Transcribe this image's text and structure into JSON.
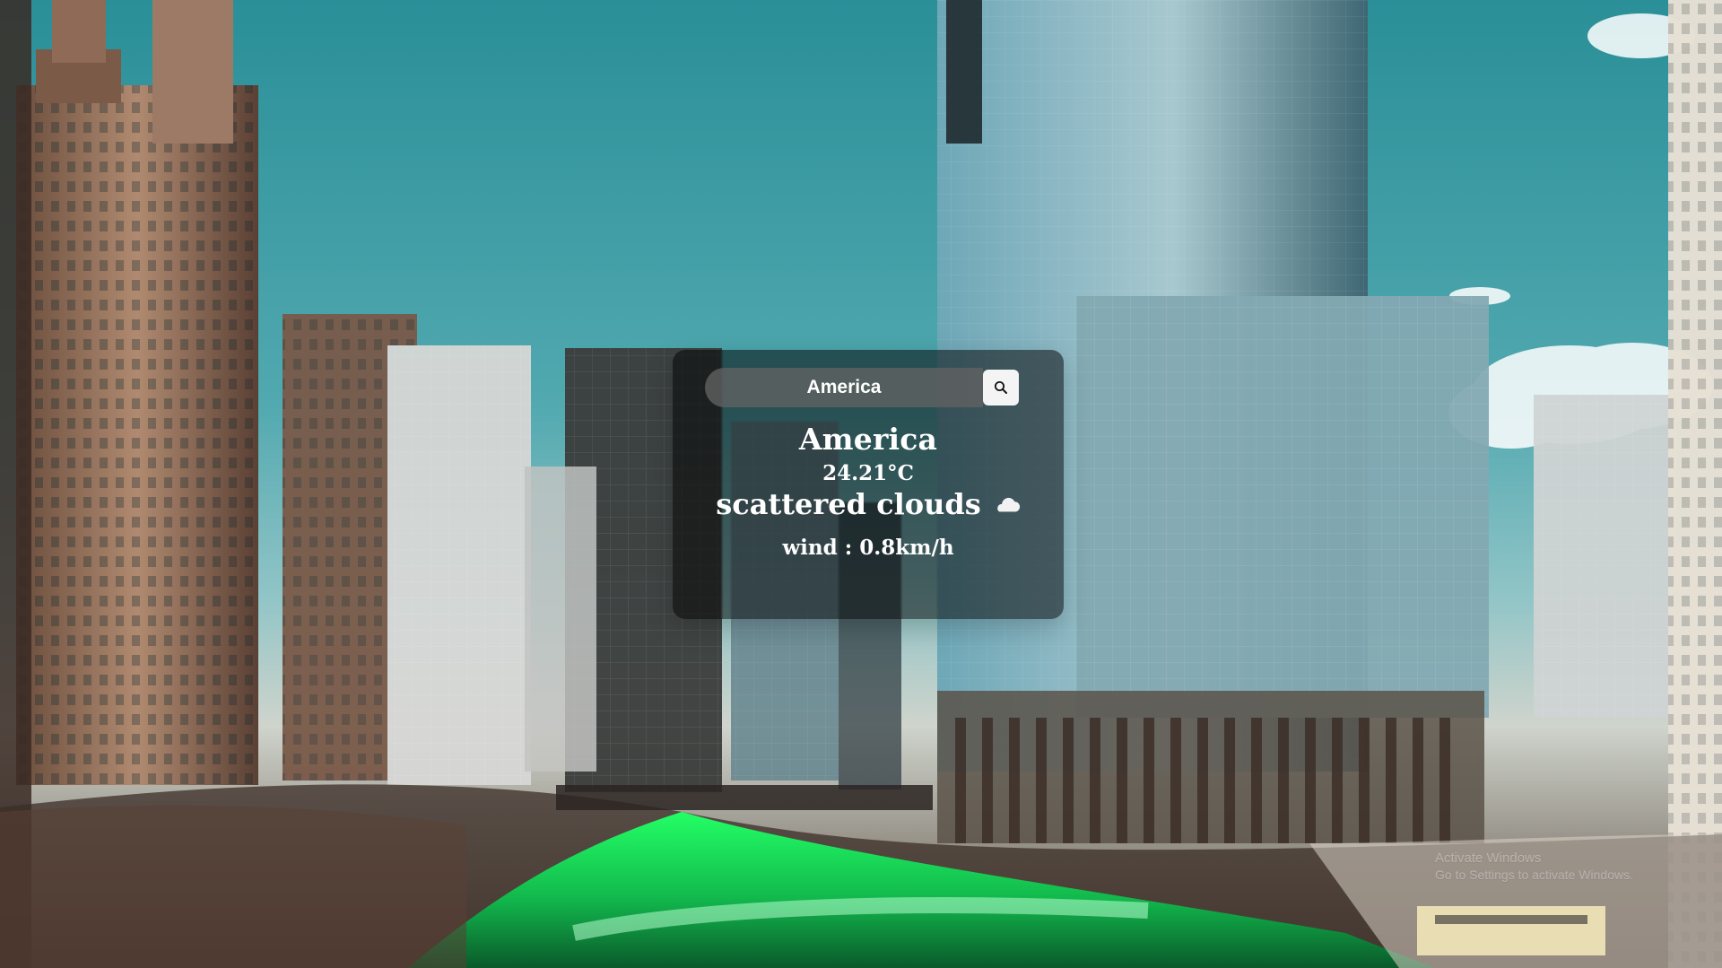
{
  "search": {
    "value": "America",
    "placeholder": ""
  },
  "weather": {
    "city": "America",
    "temperature": "24.21°C",
    "condition": "scattered clouds",
    "wind": "wind : 0.8km/h"
  },
  "watermark": {
    "line1": "Activate Windows",
    "line2": "Go to Settings to activate Windows."
  },
  "icons": {
    "search": "search-icon",
    "condition": "cloud-icon"
  },
  "colors": {
    "card_bg": "#000000",
    "input_bg": "#626262",
    "text": "#ffffff",
    "button_bg": "#f4f4f4",
    "river": "#1fff56"
  }
}
